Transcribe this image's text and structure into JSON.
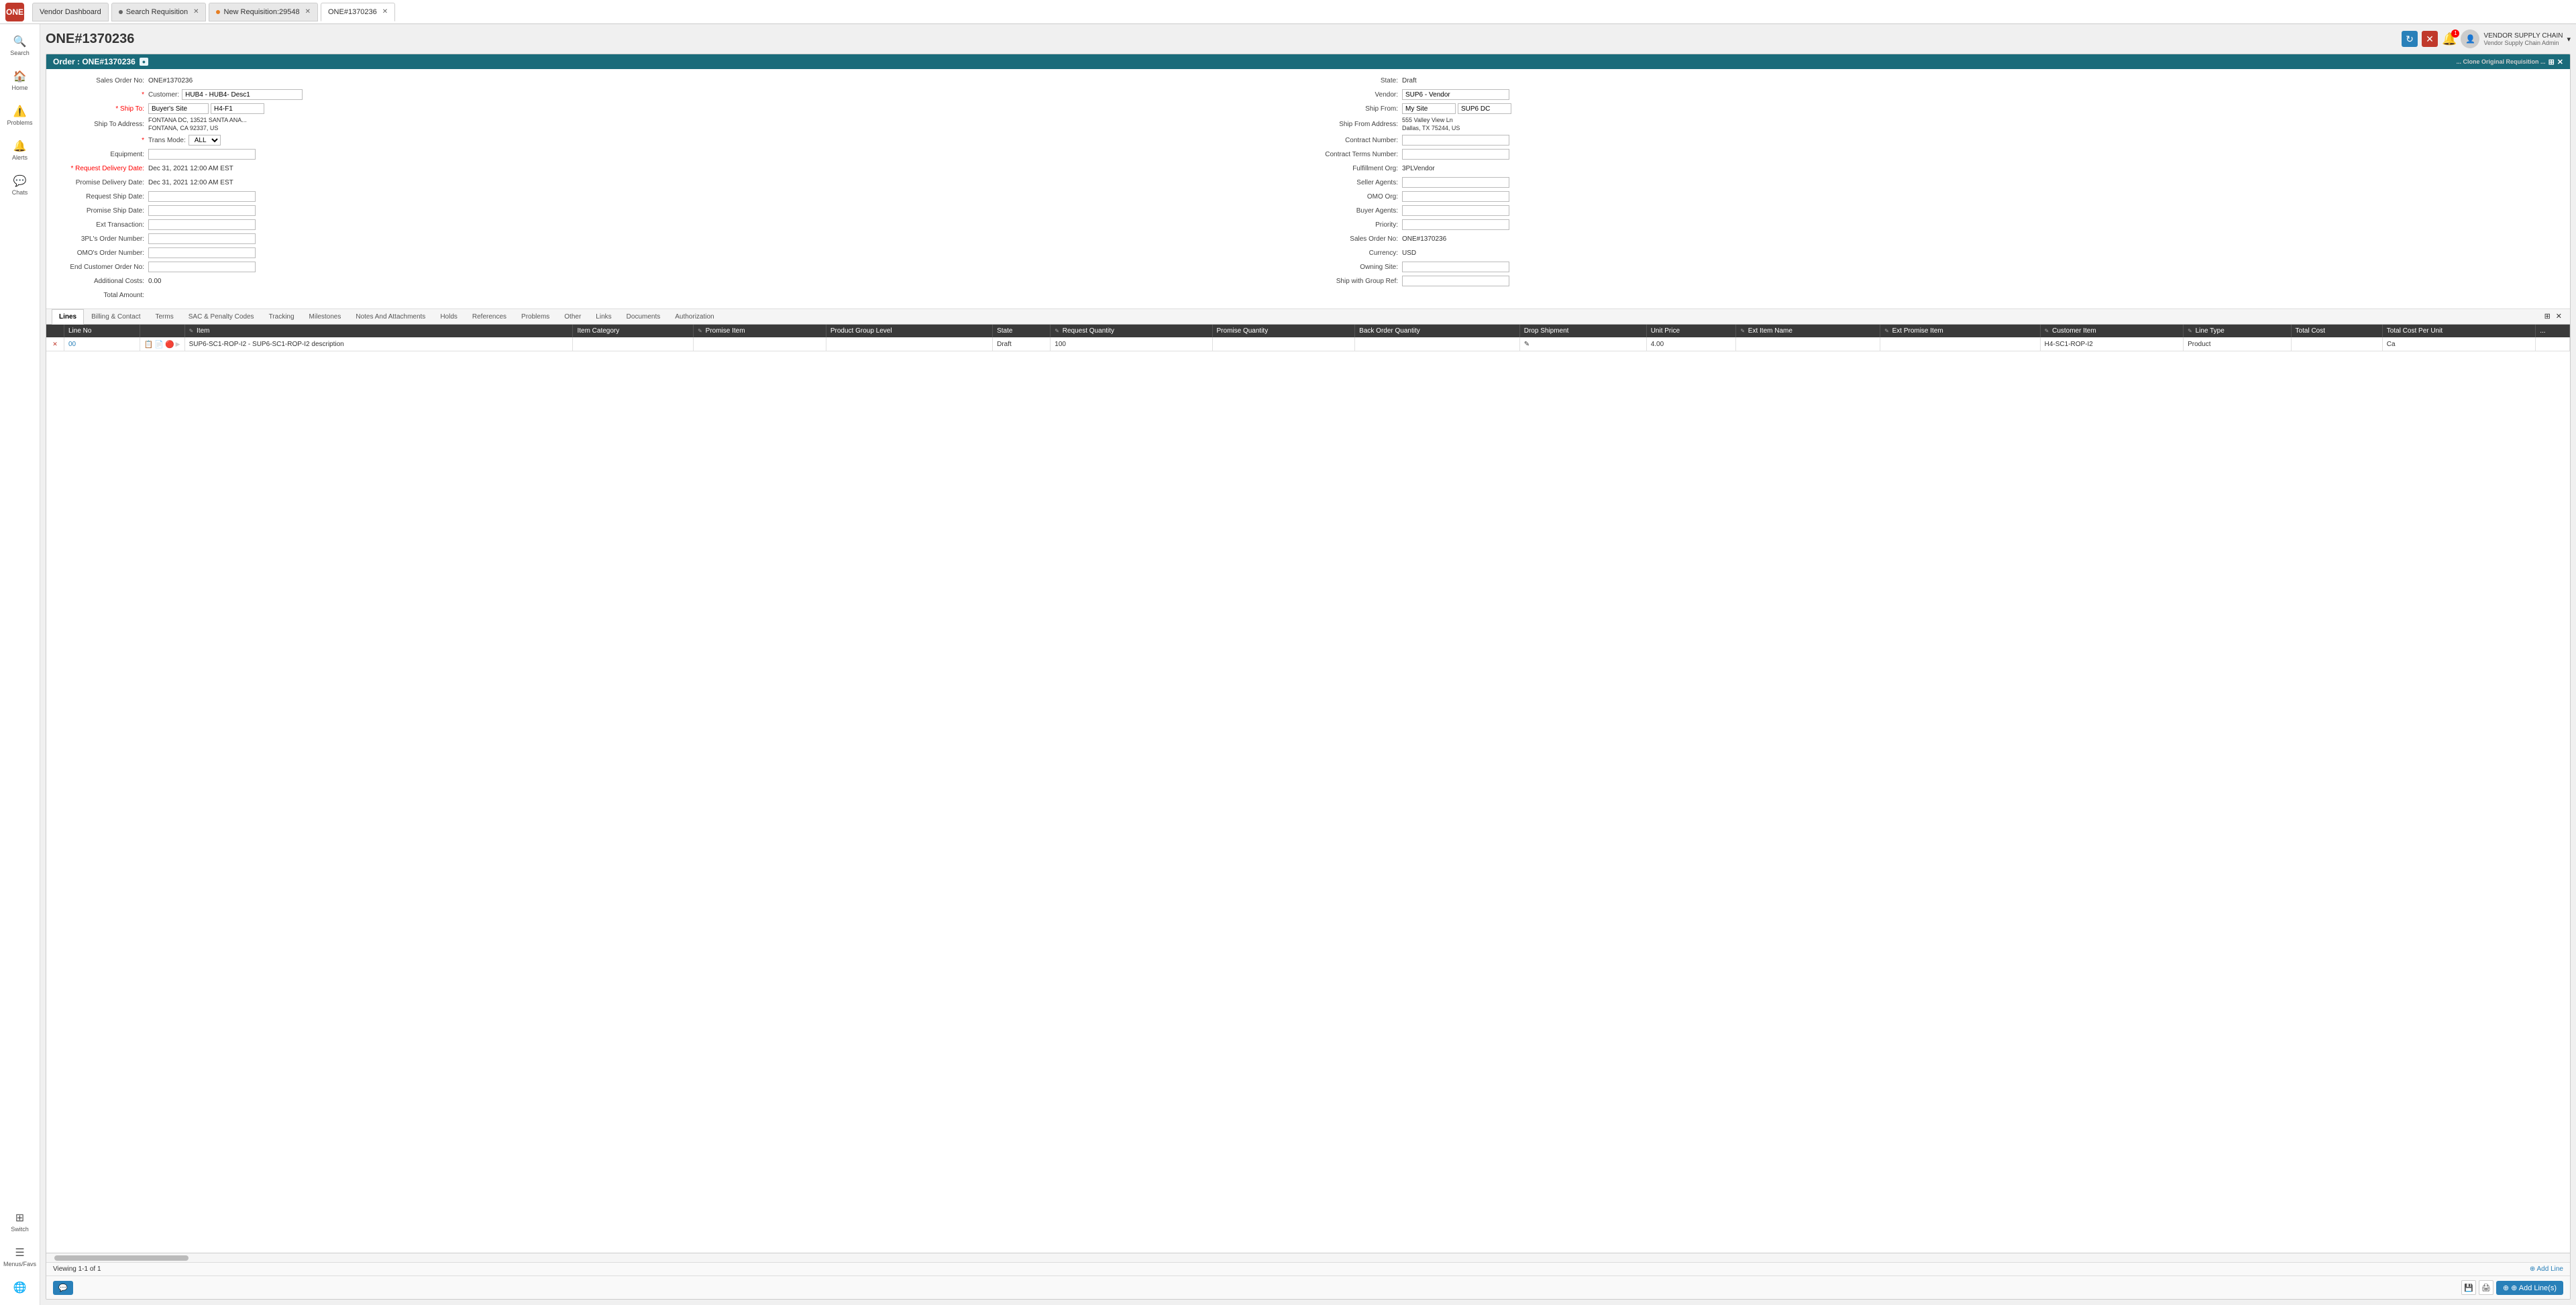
{
  "app": {
    "logo": "ONE",
    "tabs": [
      {
        "id": "vendor-dashboard",
        "label": "Vendor Dashboard",
        "active": false,
        "closable": false,
        "dot": false
      },
      {
        "id": "search-requisition",
        "label": "Search Requisition",
        "active": false,
        "closable": true,
        "dot": true,
        "dot_color": "gray"
      },
      {
        "id": "new-requisition",
        "label": "New Requisition:29548",
        "active": false,
        "closable": true,
        "dot": true,
        "dot_color": "orange"
      },
      {
        "id": "one-order",
        "label": "ONE#1370236",
        "active": true,
        "closable": true,
        "dot": false
      }
    ]
  },
  "sidebar": {
    "items": [
      {
        "id": "search",
        "icon": "🔍",
        "label": "Search"
      },
      {
        "id": "home",
        "icon": "🏠",
        "label": "Home"
      },
      {
        "id": "problems",
        "icon": "⚠️",
        "label": "Problems"
      },
      {
        "id": "alerts",
        "icon": "🔔",
        "label": "Alerts"
      },
      {
        "id": "chats",
        "icon": "💬",
        "label": "Chats"
      }
    ],
    "bottom_items": [
      {
        "id": "switch",
        "icon": "⊞",
        "label": "Switch"
      },
      {
        "id": "menus-favs",
        "icon": "☰",
        "label": "Menus/Favs"
      }
    ],
    "globe_icon": "🌐"
  },
  "header": {
    "title": "ONE#1370236",
    "refresh_label": "↻",
    "close_label": "✕",
    "notification_count": "1",
    "user": {
      "name": "VENDOR SUPPLY CHAIN",
      "role": "Vendor Supply Chain Admin",
      "avatar": "👤"
    }
  },
  "order_panel": {
    "title": "Order : ONE#1370236",
    "badge": "●",
    "header_right": "... Clone Original Requisition ...",
    "form": {
      "left": [
        {
          "label": "Sales Order No:",
          "value": "ONE#1370236",
          "required": false,
          "type": "text"
        },
        {
          "label": "* Customer:",
          "value": "HUB4 - HUB4- Desc1",
          "required": true,
          "type": "input"
        },
        {
          "label": "* Ship To:",
          "value": "Buyer's Site",
          "value2": "H4-F1",
          "required": true,
          "type": "dual"
        },
        {
          "label": "Ship To Address:",
          "value": "FONTANA DC, 13521 SANTA ANA...\nFONTANA, CA 92337, US",
          "required": false,
          "type": "text"
        },
        {
          "label": "* Trans Mode:",
          "value": "ALL",
          "required": true,
          "type": "select"
        },
        {
          "label": "Equipment:",
          "value": "",
          "required": false,
          "type": "input"
        },
        {
          "label": "* Request Delivery Date:",
          "value": "Dec 31, 2021 12:00 AM EST",
          "required": true,
          "type": "text"
        },
        {
          "label": "Promise Delivery Date:",
          "value": "Dec 31, 2021 12:00 AM EST",
          "required": false,
          "type": "text"
        },
        {
          "label": "Request Ship Date:",
          "value": "",
          "required": false,
          "type": "input"
        },
        {
          "label": "Promise Ship Date:",
          "value": "",
          "required": false,
          "type": "input"
        },
        {
          "label": "Ext Transaction:",
          "value": "",
          "required": false,
          "type": "input"
        },
        {
          "label": "3PL's Order Number:",
          "value": "",
          "required": false,
          "type": "input"
        },
        {
          "label": "OMO's Order Number:",
          "value": "",
          "required": false,
          "type": "input"
        },
        {
          "label": "End Customer Order No:",
          "value": "",
          "required": false,
          "type": "input"
        },
        {
          "label": "Additional Costs:",
          "value": "0.00",
          "required": false,
          "type": "text"
        },
        {
          "label": "Total Amount:",
          "value": "",
          "required": false,
          "type": "text"
        }
      ],
      "right": [
        {
          "label": "State:",
          "value": "Draft",
          "required": false,
          "type": "text"
        },
        {
          "label": "Vendor:",
          "value": "SUP6 - Vendor",
          "required": false,
          "type": "input"
        },
        {
          "label": "Ship From:",
          "value": "My Site",
          "value2": "SUP6 DC",
          "required": false,
          "type": "dual"
        },
        {
          "label": "Ship From Address:",
          "value": "555 Valley View Ln\nDallas, TX 75244, US",
          "required": false,
          "type": "text"
        },
        {
          "label": "Contract Number:",
          "value": "",
          "required": false,
          "type": "input"
        },
        {
          "label": "Contract Terms Number:",
          "value": "",
          "required": false,
          "type": "input"
        },
        {
          "label": "Fulfillment Org:",
          "value": "3PLVendor",
          "required": false,
          "type": "text"
        },
        {
          "label": "Seller Agents:",
          "value": "",
          "required": false,
          "type": "input"
        },
        {
          "label": "OMO Org:",
          "value": "",
          "required": false,
          "type": "input"
        },
        {
          "label": "Buyer Agents:",
          "value": "",
          "required": false,
          "type": "input"
        },
        {
          "label": "Priority:",
          "value": "",
          "required": false,
          "type": "input"
        },
        {
          "label": "Sales Order No:",
          "value": "ONE#1370236",
          "required": false,
          "type": "text"
        },
        {
          "label": "Currency:",
          "value": "USD",
          "required": false,
          "type": "text"
        },
        {
          "label": "Owning Site:",
          "value": "",
          "required": false,
          "type": "input"
        },
        {
          "label": "Ship with Group Ref:",
          "value": "",
          "required": false,
          "type": "input"
        }
      ]
    },
    "tabs": [
      {
        "id": "lines",
        "label": "Lines",
        "active": true
      },
      {
        "id": "billing-contact",
        "label": "Billing & Contact",
        "active": false
      },
      {
        "id": "terms",
        "label": "Terms",
        "active": false
      },
      {
        "id": "sac-penalty",
        "label": "SAC & Penalty Codes",
        "active": false
      },
      {
        "id": "tracking",
        "label": "Tracking",
        "active": false
      },
      {
        "id": "milestones",
        "label": "Milestones",
        "active": false
      },
      {
        "id": "notes-attachments",
        "label": "Notes And Attachments",
        "active": false
      },
      {
        "id": "holds",
        "label": "Holds",
        "active": false
      },
      {
        "id": "references",
        "label": "References",
        "active": false
      },
      {
        "id": "problems",
        "label": "Problems",
        "active": false
      },
      {
        "id": "other",
        "label": "Other",
        "active": false
      },
      {
        "id": "links",
        "label": "Links",
        "active": false
      },
      {
        "id": "documents",
        "label": "Documents",
        "active": false
      },
      {
        "id": "authorization",
        "label": "Authorization",
        "active": false
      }
    ],
    "table": {
      "columns": [
        {
          "id": "controls",
          "label": ""
        },
        {
          "id": "line-no",
          "label": "Line No"
        },
        {
          "id": "row-icons",
          "label": ""
        },
        {
          "id": "item",
          "label": "✎ Item",
          "icon": true
        },
        {
          "id": "item-category",
          "label": "Item Category"
        },
        {
          "id": "promise-item",
          "label": "✎ Promise Item",
          "icon": true
        },
        {
          "id": "product-group-level",
          "label": "Product Group Level"
        },
        {
          "id": "state",
          "label": "State"
        },
        {
          "id": "request-quantity",
          "label": "✎ Request Quantity",
          "icon": true
        },
        {
          "id": "promise-quantity",
          "label": "Promise Quantity"
        },
        {
          "id": "back-order-quantity",
          "label": "Back Order Quantity"
        },
        {
          "id": "drop-shipment",
          "label": "Drop Shipment"
        },
        {
          "id": "unit-price",
          "label": "Unit Price"
        },
        {
          "id": "ext-item-name",
          "label": "✎ Ext Item Name",
          "icon": true
        },
        {
          "id": "ext-promise-item",
          "label": "✎ Ext Promise Item",
          "icon": true
        },
        {
          "id": "customer-item",
          "label": "✎ Customer Item",
          "icon": true
        },
        {
          "id": "line-type",
          "label": "✎ Line Type",
          "icon": true
        },
        {
          "id": "total-cost",
          "label": "Total Cost"
        },
        {
          "id": "total-cost-per-unit",
          "label": "Total Cost Per Unit"
        },
        {
          "id": "more",
          "label": "..."
        }
      ],
      "rows": [
        {
          "line_no": "00",
          "row_icons": [
            "📋",
            "📄",
            "🔴"
          ],
          "item": "SUP6-SC1-ROP-I2 - SUP6-SC1-ROP-I2 description",
          "item_category": "",
          "promise_item": "",
          "product_group_level": "",
          "state": "Draft",
          "request_quantity": "100",
          "promise_quantity": "",
          "back_order_quantity": "",
          "drop_shipment": "✎",
          "unit_price": "4.00",
          "ext_item_name": "",
          "ext_promise_item": "",
          "customer_item": "H4-SC1-ROP-I2",
          "line_type": "Product",
          "total_cost": "",
          "total_cost_per_unit": "Ca",
          "more": ""
        }
      ]
    },
    "footer": {
      "viewing": "Viewing 1-1 of 1",
      "add_line": "⊕ Add Line"
    },
    "bottom_bar": {
      "chat_icon": "💬",
      "save_icon": "💾",
      "add_lines_label": "⊕ Add Line(s)"
    }
  }
}
